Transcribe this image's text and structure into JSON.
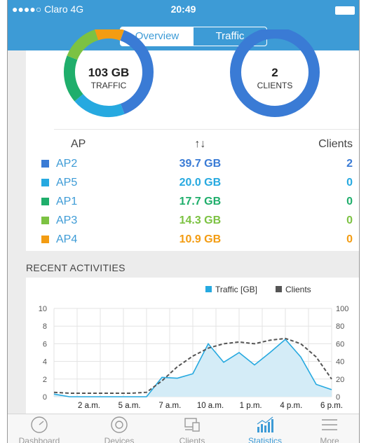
{
  "status_bar": {
    "carrier": "●●●●○ Claro  4G",
    "time": "20:49"
  },
  "segments": [
    {
      "label": "Overview",
      "active": true
    },
    {
      "label": "Traffic",
      "active": false
    }
  ],
  "summary": {
    "traffic": {
      "value": "103 GB",
      "label": "TRAFFIC"
    },
    "clients": {
      "value": "2",
      "label": "CLIENTS"
    }
  },
  "ap_table": {
    "headers": {
      "ap": "AP",
      "sort": "↑↓",
      "clients": "Clients"
    },
    "rows": [
      {
        "name": "AP2",
        "traffic": "39.7 GB",
        "clients": "2",
        "color": "#3a7bd5",
        "traffic_gb": 39.7
      },
      {
        "name": "AP5",
        "traffic": "20.0 GB",
        "clients": "0",
        "color": "#26a9e0",
        "traffic_gb": 20.0
      },
      {
        "name": "AP1",
        "traffic": "17.7 GB",
        "clients": "0",
        "color": "#1fae6b",
        "traffic_gb": 17.7
      },
      {
        "name": "AP3",
        "traffic": "14.3 GB",
        "clients": "0",
        "color": "#7cc242",
        "traffic_gb": 14.3
      },
      {
        "name": "AP4",
        "traffic": "10.9 GB",
        "clients": "0",
        "color": "#f39c12",
        "traffic_gb": 10.9
      }
    ]
  },
  "recent_activities": {
    "title": "RECENT ACTIVITIES"
  },
  "chart_data": {
    "type": "area",
    "legend": [
      {
        "name": "Traffic [GB]",
        "color": "#26a9e0"
      },
      {
        "name": "Clients",
        "color": "#555555"
      }
    ],
    "legend_position": "top-right",
    "x_ticks": [
      "2 a.m.",
      "5 a.m.",
      "7 a.m.",
      "10 a.m.",
      "1 p.m.",
      "4 p.m.",
      "6 p.m."
    ],
    "y_left": {
      "ticks": [
        "0",
        "2",
        "4",
        "6",
        "8",
        "10"
      ],
      "range": [
        0,
        10
      ]
    },
    "y_right": {
      "ticks": [
        "0",
        "20",
        "40",
        "60",
        "80",
        "100"
      ],
      "range": [
        0,
        100
      ]
    },
    "x_range": [
      0,
      18
    ],
    "grid": true,
    "series": [
      {
        "name": "Traffic [GB]",
        "x": [
          0,
          1,
          2,
          3,
          4,
          5,
          6,
          7,
          8,
          9,
          10,
          11,
          12,
          13,
          14,
          15,
          16,
          17,
          18
        ],
        "values": [
          0.3,
          0,
          0,
          0,
          0,
          0,
          0,
          2.2,
          2.1,
          2.6,
          6.0,
          3.9,
          5.0,
          3.6,
          5.0,
          6.5,
          4.5,
          1.4,
          0.8
        ]
      },
      {
        "name": "Clients",
        "x": [
          0,
          1,
          2,
          3,
          4,
          5,
          6,
          7,
          8,
          9,
          10,
          11,
          12,
          13,
          14,
          15,
          16,
          17,
          18
        ],
        "values": [
          5,
          4,
          4,
          4,
          4,
          4,
          5,
          18,
          34,
          46,
          55,
          60,
          62,
          60,
          64,
          66,
          60,
          45,
          20
        ]
      }
    ]
  },
  "tab_bar": [
    {
      "label": "Dashboard",
      "icon": "gauge-icon",
      "active": false
    },
    {
      "label": "Devices",
      "icon": "device-icon",
      "active": false
    },
    {
      "label": "Clients",
      "icon": "clients-icon",
      "active": false
    },
    {
      "label": "Statistics",
      "icon": "bar-chart-icon",
      "active": true
    },
    {
      "label": "More",
      "icon": "menu-icon",
      "active": false
    }
  ],
  "colors": {
    "accent": "#3d9bd6",
    "traffic_fill": "#d4ecf7",
    "traffic_line": "#26a9e0",
    "clients_line": "#555555"
  }
}
